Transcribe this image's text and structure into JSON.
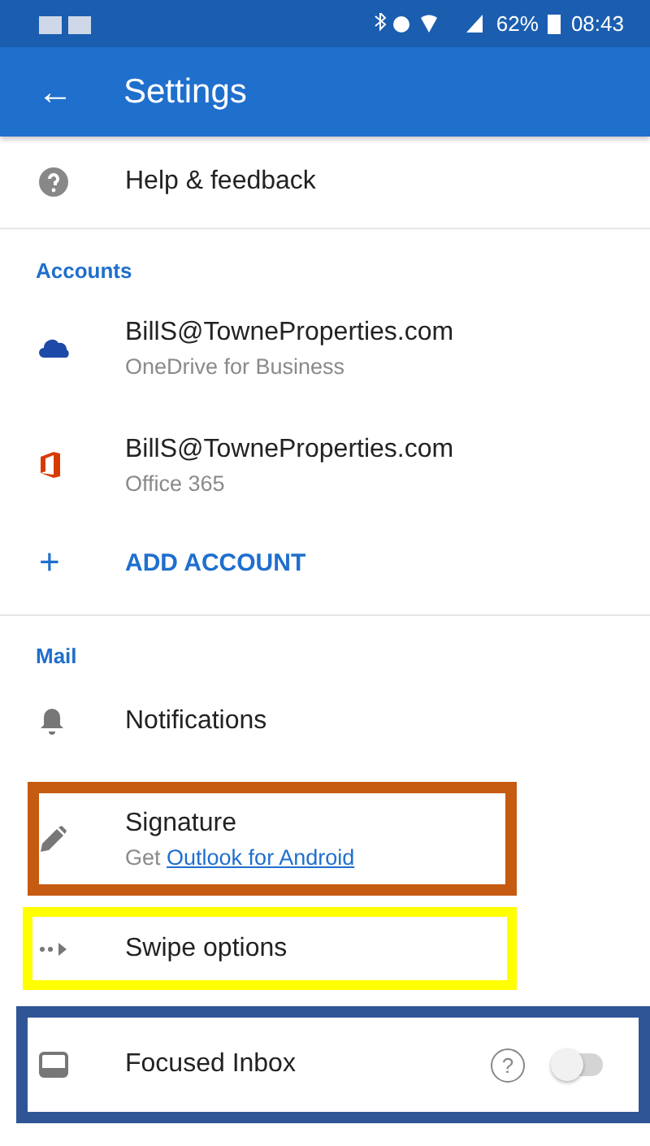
{
  "status_bar": {
    "battery": "62%",
    "time": "08:43"
  },
  "app_bar": {
    "back": "←",
    "title": "Settings"
  },
  "help": {
    "label": "Help & feedback"
  },
  "sections": [
    {
      "header": "Accounts",
      "items": [
        {
          "kind": "account",
          "title": "BillS@TowneProperties.com",
          "subtitle": "OneDrive for Business"
        },
        {
          "kind": "account",
          "title": "BillS@TowneProperties.com",
          "subtitle": "Office 365"
        },
        {
          "kind": "add",
          "symbol": "+",
          "title": "ADD ACCOUNT"
        }
      ]
    },
    {
      "header": "Mail",
      "items": [
        {
          "kind": "plain",
          "title": "Notifications"
        },
        {
          "kind": "signature",
          "title": "Signature",
          "subtitle": "Get",
          "link": "Outlook for Android",
          "color": "#c55a11"
        },
        {
          "kind": "plain",
          "title": "Swipe options",
          "color": "#ffff00"
        },
        {
          "kind": "toggle",
          "title": "Focused Inbox",
          "help": "?",
          "on": false,
          "color": "#2f5597"
        }
      ]
    }
  ]
}
